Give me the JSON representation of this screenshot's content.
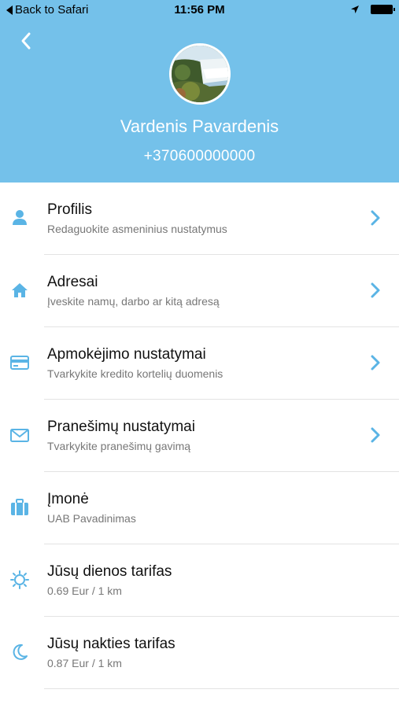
{
  "status_bar": {
    "back_label": "Back to Safari",
    "time": "11:56 PM"
  },
  "profile": {
    "name": "Vardenis Pavardenis",
    "phone": "+370600000000"
  },
  "menu": [
    {
      "title": "Profilis",
      "subtitle": "Redaguokite asmeninius nustatymus",
      "icon": "person-icon",
      "has_chevron": true
    },
    {
      "title": "Adresai",
      "subtitle": "Įveskite namų, darbo ar kitą adresą",
      "icon": "home-icon",
      "has_chevron": true
    },
    {
      "title": "Apmokėjimo nustatymai",
      "subtitle": "Tvarkykite kredito kortelių duomenis",
      "icon": "credit-card-icon",
      "has_chevron": true
    },
    {
      "title": "Pranešimų nustatymai",
      "subtitle": "Tvarkykite pranešimų gavimą",
      "icon": "envelope-icon",
      "has_chevron": true
    },
    {
      "title": "Įmonė",
      "subtitle": "UAB Pavadinimas",
      "icon": "briefcase-icon",
      "has_chevron": false
    },
    {
      "title": "Jūsų dienos tarifas",
      "subtitle": "0.69 Eur / 1 km",
      "icon": "sun-icon",
      "has_chevron": false
    },
    {
      "title": "Jūsų nakties tarifas",
      "subtitle": "0.87 Eur / 1 km",
      "icon": "moon-icon",
      "has_chevron": false
    }
  ],
  "colors": {
    "header_bg": "#74c1ea",
    "accent": "#5ab4e5"
  }
}
